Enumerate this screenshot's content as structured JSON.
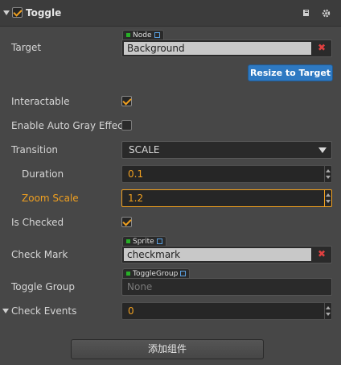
{
  "component": {
    "title": "Toggle",
    "enabled": true
  },
  "target": {
    "label": "Target",
    "type_tag": "Node",
    "value": "Background",
    "clear_label": "✖",
    "resize_button": "Resize to Target"
  },
  "interactable": {
    "label": "Interactable",
    "checked": true
  },
  "auto_gray": {
    "label": "Enable Auto Gray Effect",
    "checked": false
  },
  "transition": {
    "label": "Transition",
    "value": "SCALE"
  },
  "duration": {
    "label": "Duration",
    "value": "0.1"
  },
  "zoom_scale": {
    "label": "Zoom Scale",
    "value": "1.2"
  },
  "is_checked": {
    "label": "Is Checked",
    "checked": true
  },
  "check_mark": {
    "label": "Check Mark",
    "type_tag": "Sprite",
    "value": "checkmark",
    "clear_label": "✖"
  },
  "toggle_group": {
    "label": "Toggle Group",
    "type_tag": "ToggleGroup",
    "placeholder": "None"
  },
  "check_events": {
    "label": "Check Events",
    "value": "0"
  },
  "add_component_button": "添加组件",
  "colors": {
    "accent_orange": "#f0a020",
    "button_blue": "#2e79c2",
    "clear_red": "#e04040",
    "node_green": "#28b028"
  }
}
